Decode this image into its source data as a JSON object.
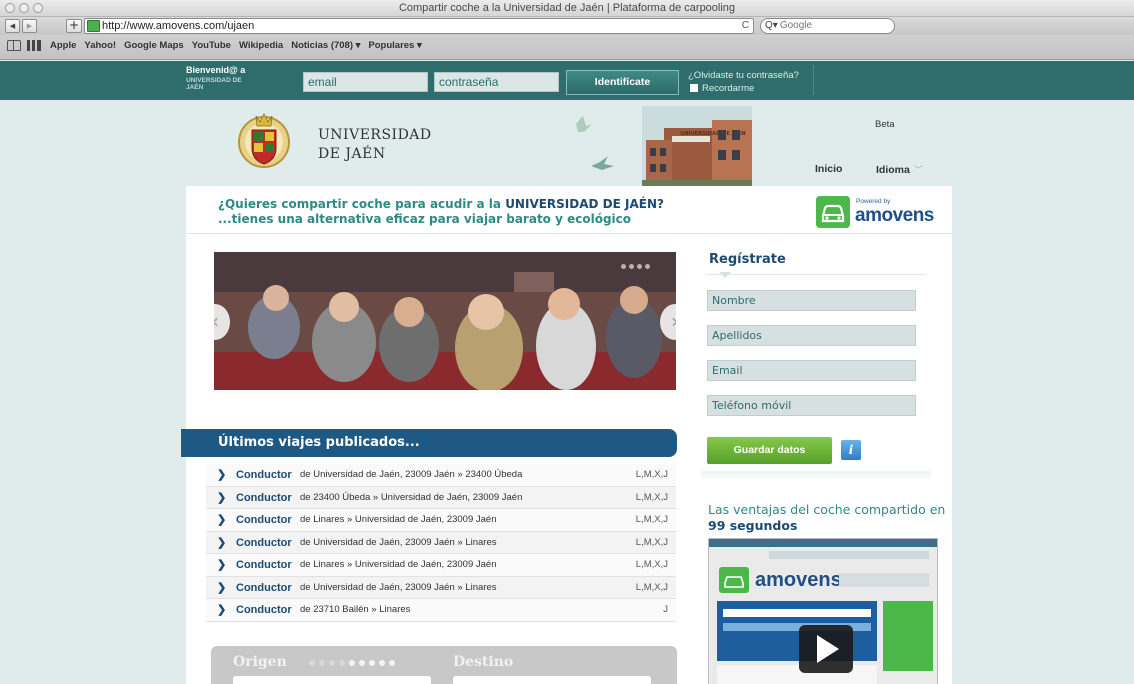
{
  "browser": {
    "title": "Compartir coche a la Universidad de Jaén | Plataforma de carpooling",
    "url": "http://www.amovens.com/ujaen",
    "search_placeholder": "Google",
    "bookmarks": [
      "Apple",
      "Yahoo!",
      "Google Maps",
      "YouTube",
      "Wikipedia",
      "Noticias (708) ▾",
      "Populares ▾"
    ]
  },
  "login": {
    "welcome": "Bienvenid@ a",
    "welcome_org": "UNIVERSIDAD DE JAÉN",
    "email_placeholder": "email",
    "password_placeholder": "contraseña",
    "submit_label": "Identifícate",
    "forgot_label": "¿Olvidaste tu contraseña?",
    "remember_label": "Recordarme"
  },
  "header": {
    "university_line1": "UNIVERSIDAD",
    "university_line2": "DE JAÉN",
    "building_sign": "UNIVERSIDAD DE JAÉN",
    "beta_label": "Beta",
    "nav": {
      "home": "Inicio",
      "language": "Idioma"
    }
  },
  "promo": {
    "line1_prefix": "¿Quieres compartir coche para acudir a la ",
    "line1_highlight": "UNIVERSIDAD DE JAÉN?",
    "line2": "...tienes una alternativa eficaz para viajar barato y ecológico",
    "powered_by": "Powered by",
    "brand": "amovens"
  },
  "trips": {
    "heading": "Últimos viajes publicados...",
    "items": [
      {
        "role": "Conductor",
        "route": "de Universidad de Jaén, 23009 Jaén » 23400 Úbeda",
        "days": "L,M,X,J"
      },
      {
        "role": "Conductor",
        "route": "de 23400 Úbeda » Universidad de Jaén, 23009 Jaén",
        "days": "L,M,X,J"
      },
      {
        "role": "Conductor",
        "route": "de Linares » Universidad de Jaén, 23009 Jaén",
        "days": "L,M,X,J"
      },
      {
        "role": "Conductor",
        "route": "de Universidad de Jaén, 23009 Jaén » Linares",
        "days": "L,M,X,J"
      },
      {
        "role": "Conductor",
        "route": "de Linares » Universidad de Jaén, 23009 Jaén",
        "days": "L,M,X,J"
      },
      {
        "role": "Conductor",
        "route": "de Universidad de Jaén, 23009 Jaén » Linares",
        "days": "L,M,X,J"
      },
      {
        "role": "Conductor",
        "route": "de 23710 Bailén » Linares",
        "days": "J"
      }
    ]
  },
  "search": {
    "origin_label": "Origen",
    "destination_label": "Destino"
  },
  "register": {
    "title": "Regístrate",
    "fields": [
      "Nombre",
      "Apellidos",
      "Email",
      "Teléfono móvil"
    ],
    "submit_label": "Guardar datos",
    "info_icon": "i"
  },
  "video": {
    "title_prefix": "Las ventajas del coche compartido en ",
    "title_bold": "99 segundos",
    "brand": "amovens"
  },
  "colors": {
    "teal_bar": "#2e6d6b",
    "navy": "#1d4a72",
    "brand_green": "#4cb84a",
    "page_bg": "#e0ecec"
  }
}
